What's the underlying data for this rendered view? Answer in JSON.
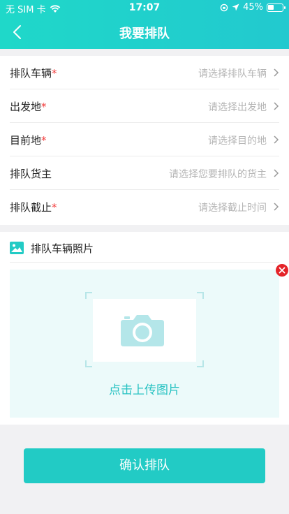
{
  "status_bar": {
    "carrier": "无 SIM 卡",
    "time": "17:07",
    "battery": "45%",
    "battery_level": 0.45
  },
  "nav": {
    "back_icon": "chevron-left-icon",
    "title": "我要排队"
  },
  "form": {
    "rows": [
      {
        "label": "排队车辆",
        "required": "*",
        "placeholder": "请选择排队车辆"
      },
      {
        "label": "出发地",
        "required": "*",
        "placeholder": "请选择出发地"
      },
      {
        "label": "目前地",
        "required": "*",
        "placeholder": "请选择目的地"
      },
      {
        "label": "排队货主",
        "required": "",
        "placeholder": "请选择您要排队的货主"
      },
      {
        "label": "排队截止",
        "required": "*",
        "placeholder": "请选择截止时间"
      }
    ]
  },
  "photo": {
    "icon": "image-icon",
    "title": "排队车辆照片",
    "upload_icon": "camera-icon",
    "upload_text": "点击上传图片",
    "remove_icon": "close-icon"
  },
  "actions": {
    "confirm_label": "确认排队"
  },
  "colors": {
    "brand": "#22cbc5",
    "required": "#f23b3b",
    "remove": "#e42429"
  }
}
